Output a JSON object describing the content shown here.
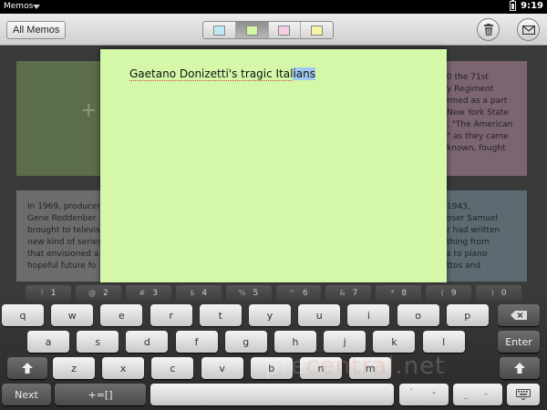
{
  "status_bar": {
    "app_name": "Memos",
    "time": "9:19"
  },
  "toolbar": {
    "all_memos_label": "All Memos",
    "swatches": [
      {
        "name": "blue",
        "color": "#bfe8f6"
      },
      {
        "name": "green",
        "color": "#d4f7a8",
        "selected": true
      },
      {
        "name": "pink",
        "color": "#f7cde5"
      },
      {
        "name": "yellow",
        "color": "#f7f3a8"
      }
    ],
    "delete_icon": "trash-icon",
    "email_icon": "envelope-icon"
  },
  "memo_grid": {
    "tile_top_right_lines": [
      "0 the 71st",
      "y Regiment",
      "rmed as a part",
      "New York State",
      ". \"The American",
      "\" as they came",
      "known, fought"
    ],
    "tile_bottom_left_lines": [
      "In 1969, producer",
      "Gene Roddenber",
      "brought to televis",
      "new kind of series",
      "that envisioned a",
      "hopeful future fo"
    ],
    "tile_bottom_right_lines": [
      "1943,",
      "oser Samuel",
      "r had written",
      "thing from",
      "s to piano",
      "ttos and"
    ]
  },
  "memo": {
    "text_plain": "Gaetano Donizetti's tragic Ital",
    "text_selected": "ians"
  },
  "keyboard": {
    "number_row": [
      {
        "shift": "!",
        "main": "1"
      },
      {
        "shift": "@",
        "main": "2"
      },
      {
        "shift": "#",
        "main": "3"
      },
      {
        "shift": "$",
        "main": "4"
      },
      {
        "shift": "%",
        "main": "5"
      },
      {
        "shift": "^",
        "main": "6"
      },
      {
        "shift": "&",
        "main": "7"
      },
      {
        "shift": "*",
        "main": "8"
      },
      {
        "shift": "(",
        "main": "9"
      },
      {
        "shift": ")",
        "main": "0"
      }
    ],
    "row1": [
      "q",
      "w",
      "e",
      "r",
      "t",
      "y",
      "u",
      "i",
      "o",
      "p"
    ],
    "row2": [
      "a",
      "s",
      "d",
      "f",
      "g",
      "h",
      "j",
      "k",
      "l"
    ],
    "row3": [
      "z",
      "x",
      "c",
      "v",
      "b",
      "n",
      "m"
    ],
    "enter_label": "Enter",
    "next_label": "Next",
    "symbols_label": "+=[]",
    "apostrophe": "'",
    "quote": "\"",
    "underscore": "_",
    "dash": "–",
    "watermark_a": "pre",
    "watermark_b": "central",
    "watermark_c": ".net"
  }
}
